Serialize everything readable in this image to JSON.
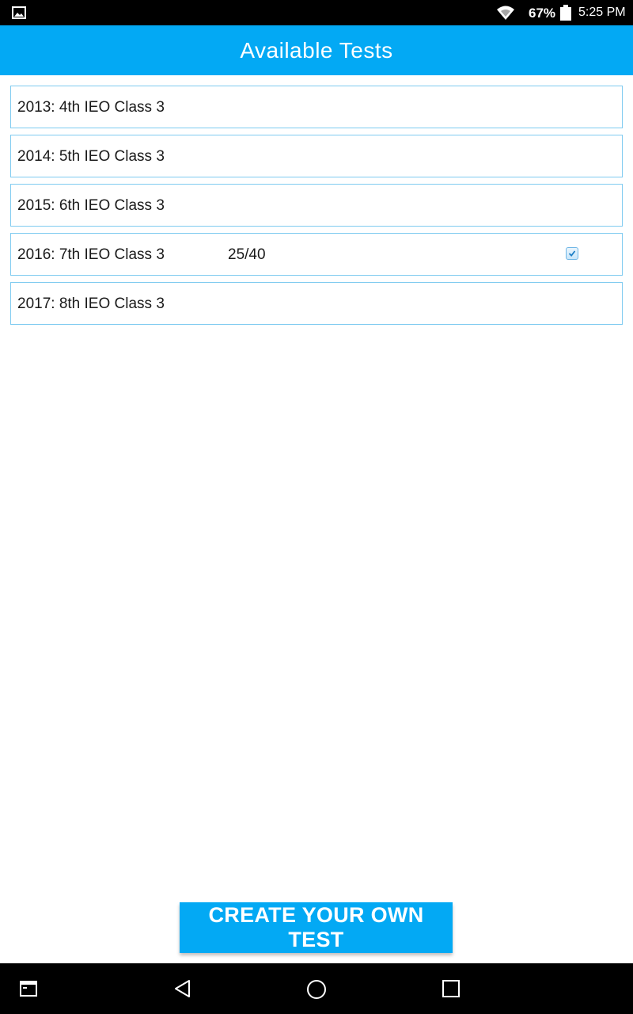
{
  "status_bar": {
    "battery_percent": "67%",
    "time": "5:25 PM",
    "icons": [
      "image-icon",
      "wifi-icon",
      "battery-icon"
    ]
  },
  "app_bar": {
    "title": "Available Tests"
  },
  "tests": [
    {
      "name": "2013: 4th IEO Class 3",
      "score": "",
      "checked": false
    },
    {
      "name": "2014: 5th IEO Class 3",
      "score": "",
      "checked": false
    },
    {
      "name": "2015: 6th IEO Class 3",
      "score": "",
      "checked": false
    },
    {
      "name": "2016: 7th IEO Class 3",
      "score": "25/40",
      "checked": true
    },
    {
      "name": "2017: 8th IEO Class 3",
      "score": "",
      "checked": false
    }
  ],
  "create_button": {
    "label": "CREATE YOUR OWN TEST"
  },
  "nav_bar": {
    "icons": [
      "recent-apps-icon",
      "back-icon",
      "home-icon",
      "overview-icon"
    ]
  },
  "colors": {
    "accent": "#03a9f4",
    "item_border": "#7fcbf0"
  }
}
